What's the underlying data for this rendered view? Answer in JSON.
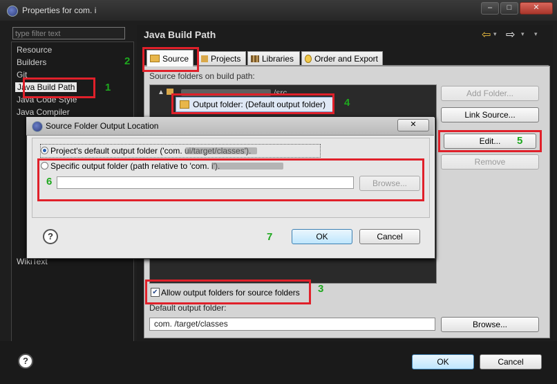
{
  "window": {
    "title": "Properties for com.     i"
  },
  "filter": {
    "placeholder": "type filter text"
  },
  "nav": {
    "items": [
      "Resource",
      "Builders",
      "Git",
      "Java Build Path",
      "Java Code Style",
      "Java Compiler"
    ],
    "lower_items": [
      "WikiText"
    ]
  },
  "panel": {
    "title": "Java Build Path"
  },
  "tabs": [
    {
      "label": "Source",
      "icon": "source-folder-icon"
    },
    {
      "label": "Projects",
      "icon": "projects-icon"
    },
    {
      "label": "Libraries",
      "icon": "libraries-icon"
    },
    {
      "label": "Order and Export",
      "icon": "order-export-icon"
    }
  ],
  "source": {
    "folders_label": "Source folders on build path:",
    "tree_root": "/src",
    "output_folder_item": "Output folder: (Default output folder)",
    "buttons": {
      "add_folder": "Add Folder...",
      "link_source": "Link Source...",
      "edit": "Edit...",
      "remove": "Remove"
    },
    "allow_output_label": "Allow output folders for source folders",
    "default_output_label": "Default output folder:",
    "default_output_value": "com.           /target/classes",
    "browse": "Browse..."
  },
  "dialog": {
    "title": "Source Folder Output Location",
    "close_glyph": "✕",
    "option_default": "Project's default output folder ('com.                ui/target/classes').",
    "option_specific": "Specific output folder (path relative to 'com.                   i').",
    "path_value": "",
    "browse": "Browse...",
    "ok": "OK",
    "cancel": "Cancel"
  },
  "footer": {
    "ok": "OK",
    "cancel": "Cancel",
    "help_glyph": "?"
  },
  "annotations": [
    "1",
    "2",
    "3",
    "4",
    "5",
    "6",
    "7"
  ],
  "colors": {
    "annotation_box": "#e0202a",
    "annotation_number": "#1ea81e",
    "nav_arrow": "#f0c040"
  }
}
